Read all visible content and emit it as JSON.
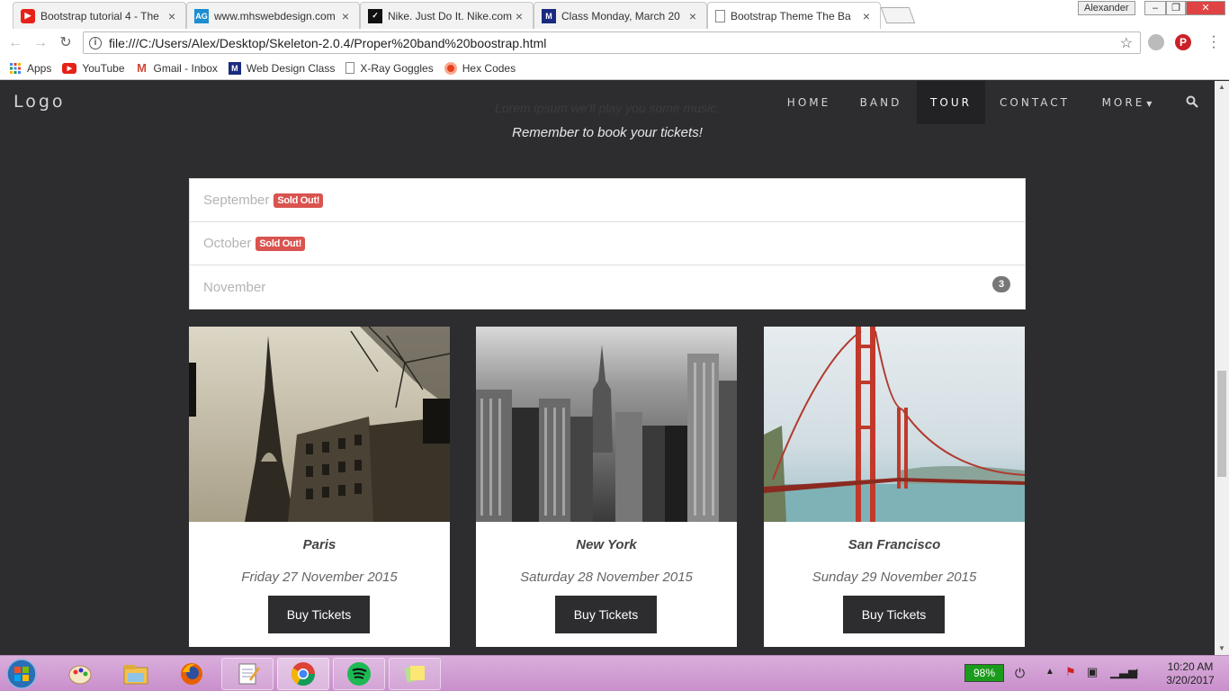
{
  "browser": {
    "tabs": [
      {
        "title": "Bootstrap tutorial 4 - The",
        "icon": "youtube-icon",
        "color": "#e62117"
      },
      {
        "title": "www.mhswebdesign.com",
        "icon": "ag-icon",
        "color": "#1d8ecf"
      },
      {
        "title": "Nike. Just Do It. Nike.com",
        "icon": "nike-icon",
        "color": "#111111"
      },
      {
        "title": "Class Monday, March 20",
        "icon": "m-icon",
        "color": "#1a2a80"
      },
      {
        "title": "Bootstrap Theme The Ba",
        "icon": "page-icon",
        "color": "#888888"
      }
    ],
    "profile_name": "Alexander",
    "url": "file:///C:/Users/Alex/Desktop/Skeleton-2.0.4/Proper%20band%20boostrap.html",
    "bookmarks": [
      {
        "label": "Apps",
        "icon": "apps-grid-icon"
      },
      {
        "label": "YouTube",
        "icon": "youtube-icon"
      },
      {
        "label": "Gmail - Inbox",
        "icon": "gmail-icon"
      },
      {
        "label": "Web Design Class",
        "icon": "m-icon"
      },
      {
        "label": "X-Ray Goggles",
        "icon": "page-icon"
      },
      {
        "label": "Hex Codes",
        "icon": "hex-icon"
      }
    ]
  },
  "page": {
    "logo": "Logo",
    "nav": [
      {
        "label": "HOME",
        "active": false
      },
      {
        "label": "BAND",
        "active": false
      },
      {
        "label": "TOUR",
        "active": true
      },
      {
        "label": "CONTACT",
        "active": false
      },
      {
        "label": "MORE",
        "active": false
      }
    ],
    "intro_line1": "Lorem ipsum we'll play you some music.",
    "intro_line2": "Remember to book your tickets!",
    "months": [
      {
        "label": "September",
        "badge": "Sold Out!"
      },
      {
        "label": "October",
        "badge": "Sold Out!"
      },
      {
        "label": "November",
        "count": "3"
      }
    ],
    "cards": [
      {
        "city": "Paris",
        "date": "Friday 27 November 2015",
        "button": "Buy Tickets"
      },
      {
        "city": "New York",
        "date": "Saturday 28 November 2015",
        "button": "Buy Tickets"
      },
      {
        "city": "San Francisco",
        "date": "Sunday 29 November 2015",
        "button": "Buy Tickets"
      }
    ]
  },
  "taskbar": {
    "battery": "98%",
    "time": "10:20 AM",
    "date": "3/20/2017",
    "apps": [
      "paint-icon",
      "file-explorer-icon",
      "firefox-icon",
      "notepad-icon",
      "chrome-icon",
      "spotify-icon",
      "sticky-notes-icon"
    ]
  }
}
